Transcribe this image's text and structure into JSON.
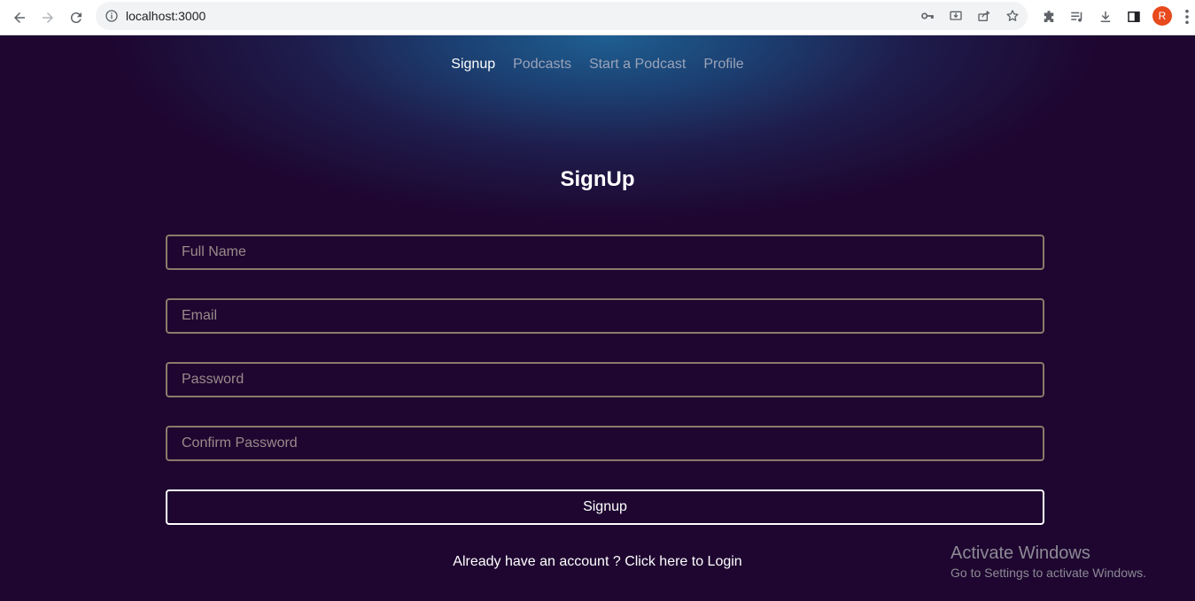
{
  "browser": {
    "url": "localhost:3000",
    "profile_initial": "R"
  },
  "nav": {
    "items": [
      "Signup",
      "Podcasts",
      "Start a Podcast",
      "Profile"
    ]
  },
  "form": {
    "title": "SignUp",
    "fields": {
      "full_name": {
        "placeholder": "Full Name"
      },
      "email": {
        "placeholder": "Email"
      },
      "password": {
        "placeholder": "Password"
      },
      "confirm_password": {
        "placeholder": "Confirm Password"
      }
    },
    "submit_label": "Signup",
    "login_text": "Already have an account ? Click here to Login"
  },
  "watermark": {
    "title": "Activate Windows",
    "subtitle": "Go to Settings to activate Windows."
  },
  "colors": {
    "background": "#1e0630",
    "glow": "#1e5f92",
    "input_border": "#8c7a6b",
    "avatar": "#e8491d"
  }
}
